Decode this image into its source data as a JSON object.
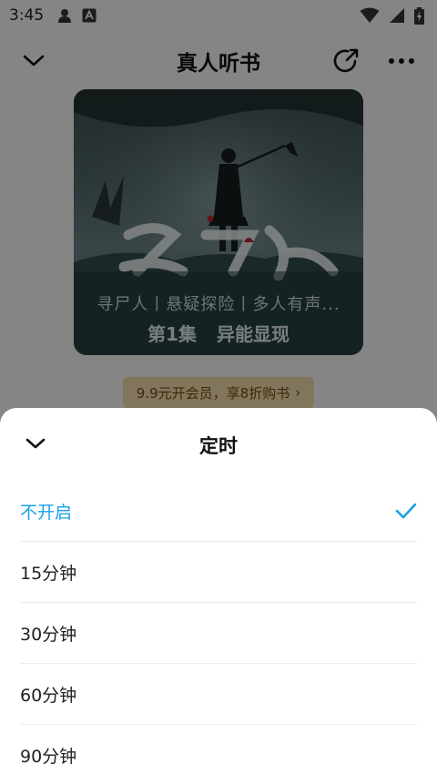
{
  "status_bar": {
    "time": "3:45",
    "icons": [
      "avatar-icon",
      "a-icon",
      "wifi-icon",
      "signal-icon",
      "battery-icon"
    ]
  },
  "nav": {
    "title": "真人听书",
    "icons": [
      "chevron-down-icon",
      "share-icon",
      "more-icon"
    ]
  },
  "cover": {
    "subtitle": "寻尸人丨悬疑探险丨多人有声...",
    "episode_number": "第1集",
    "episode_title": "异能显现"
  },
  "promo": {
    "text": "9.9元开会员，享8折购书",
    "arrow": "›"
  },
  "timer_sheet": {
    "title": "定时",
    "options": [
      {
        "label": "不开启",
        "selected": true
      },
      {
        "label": "15分钟",
        "selected": false
      },
      {
        "label": "30分钟",
        "selected": false
      },
      {
        "label": "60分钟",
        "selected": false
      },
      {
        "label": "90分钟",
        "selected": false
      }
    ]
  },
  "colors": {
    "accent": "#1aa0e8",
    "promo_bg": "#ecd8a8",
    "promo_text": "#6b4a16",
    "overlay": "rgba(0,0,0,0.45)"
  }
}
